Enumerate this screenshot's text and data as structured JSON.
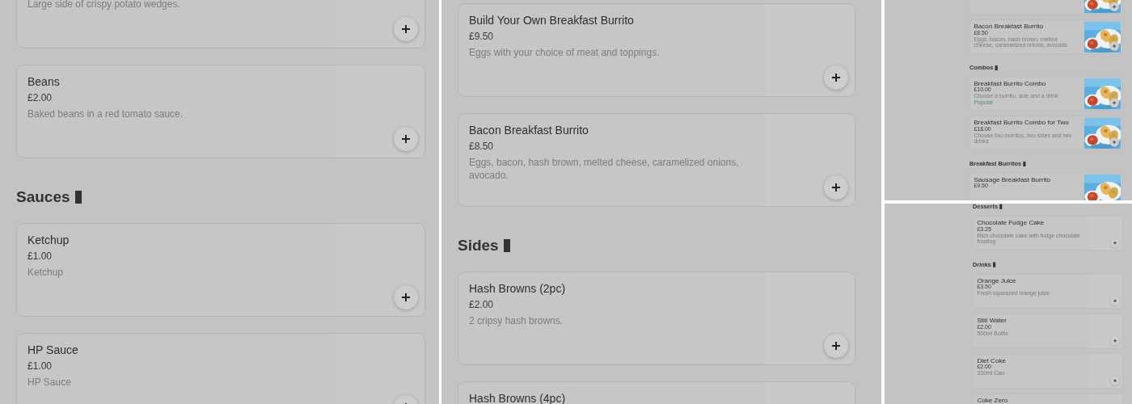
{
  "panels": [
    {
      "entries": [
        {
          "kind": "item",
          "description": "Large side of crispy potato wedges.",
          "photo": false
        },
        {
          "kind": "item",
          "title": "Beans",
          "price": "£2.00",
          "description": "Baked beans in a red tomato sauce.",
          "photo": false
        },
        {
          "kind": "heading",
          "text": "Sauces"
        },
        {
          "kind": "item",
          "title": "Ketchup",
          "price": "£1.00",
          "description": "Ketchup",
          "photo": false
        },
        {
          "kind": "item",
          "title": "HP Sauce",
          "price": "£1.00",
          "description": "HP Sauce",
          "photo": false
        }
      ]
    },
    {
      "entries": [
        {
          "kind": "item",
          "title": "Build Your Own Breakfast Burrito",
          "price": "£9.50",
          "description": "Eggs with your choice of meat and toppings.",
          "photo": false
        },
        {
          "kind": "item",
          "title": "Bacon Breakfast Burrito",
          "price": "£8.50",
          "description": "Eggs, bacon, hash brown, melted cheese, caramelized onions, avocado.",
          "photo": false
        },
        {
          "kind": "heading",
          "text": "Sides"
        },
        {
          "kind": "item",
          "title": "Hash Browns (2pc)",
          "price": "£2.00",
          "description": "2 cripsy hash browns.",
          "photo": false
        },
        {
          "kind": "item",
          "title": "Hash Browns (4pc)",
          "photo": false
        }
      ]
    },
    {
      "entries": [
        {
          "kind": "item",
          "photo": true
        },
        {
          "kind": "item",
          "title": "Bacon Breakfast Burrito",
          "price": "£8.50",
          "description": "Eggs, bacon, hash brown, melted cheese, caramelized onions, avocado",
          "photo": true
        },
        {
          "kind": "heading",
          "text": "Combos"
        },
        {
          "kind": "item",
          "title": "Breakfast Burrito Combo",
          "price": "£10.00",
          "description": "Choose a burrito, side and a drink",
          "tag": "Popular",
          "photo": true
        },
        {
          "kind": "item",
          "title": "Breakfast Burrito Combo for Two",
          "price": "£18.00",
          "description": "Choose two burritos, two sides and two drinks",
          "photo": true
        },
        {
          "kind": "heading",
          "text": "Breakfast Burritos"
        },
        {
          "kind": "item",
          "title": "Sausage Breakfast Burrito",
          "price": "£9.50",
          "photo": true
        }
      ]
    },
    {
      "entries": [
        {
          "kind": "heading",
          "text": "Desserts"
        },
        {
          "kind": "item",
          "title": "Chocolate Fudge Cake",
          "price": "£3.25",
          "description": "Rich chocolate cake with fudge chocolate frosting",
          "photo": false
        },
        {
          "kind": "heading",
          "text": "Drinks"
        },
        {
          "kind": "item",
          "title": "Orange Juice",
          "price": "£3.50",
          "description": "Fresh squeezed orange juice",
          "photo": false
        },
        {
          "kind": "item",
          "title": "Still Water",
          "price": "£2.00",
          "description": "500ml Bottle",
          "photo": false
        },
        {
          "kind": "item",
          "title": "Diet Coke",
          "price": "£2.00",
          "description": "330ml Can",
          "photo": false
        },
        {
          "kind": "item",
          "title": "Coke Zero",
          "photo": false
        }
      ]
    }
  ]
}
